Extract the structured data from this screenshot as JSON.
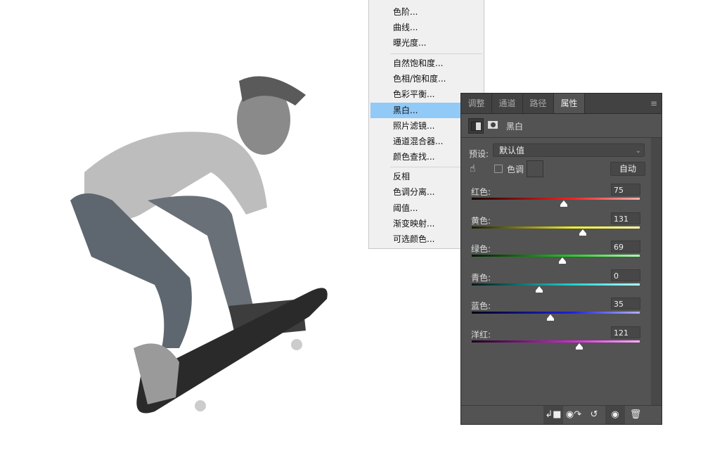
{
  "menu": {
    "items": [
      "色阶...",
      "曲线...",
      "曝光度...",
      "自然饱和度...",
      "色相/饱和度...",
      "色彩平衡...",
      "黑白...",
      "照片滤镜...",
      "通道混合器...",
      "颜色查找...",
      "反相",
      "色调分离...",
      "阈值...",
      "渐变映射...",
      "可选颜色..."
    ],
    "highlighted": "黑白..."
  },
  "panel": {
    "tabs": [
      "调整",
      "通道",
      "路径",
      "属性"
    ],
    "active_tab": "属性",
    "title": "黑白",
    "preset_label": "预设:",
    "preset_value": "默认值",
    "tint_label": "色调",
    "tint_checked": false,
    "auto_label": "自动",
    "sliders": [
      {
        "label": "红色:",
        "value": "75",
        "colors": [
          "#1a0000",
          "#ff2020",
          "#ffb0b0"
        ]
      },
      {
        "label": "黄色:",
        "value": "131",
        "colors": [
          "#1a1a00",
          "#f0f020",
          "#ffffb0"
        ]
      },
      {
        "label": "绿色:",
        "value": "69",
        "colors": [
          "#001a00",
          "#20d020",
          "#b0ffb0"
        ]
      },
      {
        "label": "青色:",
        "value": "0",
        "colors": [
          "#001a1a",
          "#20d0d0",
          "#b0ffff"
        ]
      },
      {
        "label": "蓝色:",
        "value": "35",
        "colors": [
          "#00001a",
          "#2020e0",
          "#b0b0ff"
        ]
      },
      {
        "label": "洋红:",
        "value": "121",
        "colors": [
          "#1a001a",
          "#e020e0",
          "#ffb0ff"
        ]
      }
    ],
    "slider_range": [
      -200,
      300
    ]
  }
}
